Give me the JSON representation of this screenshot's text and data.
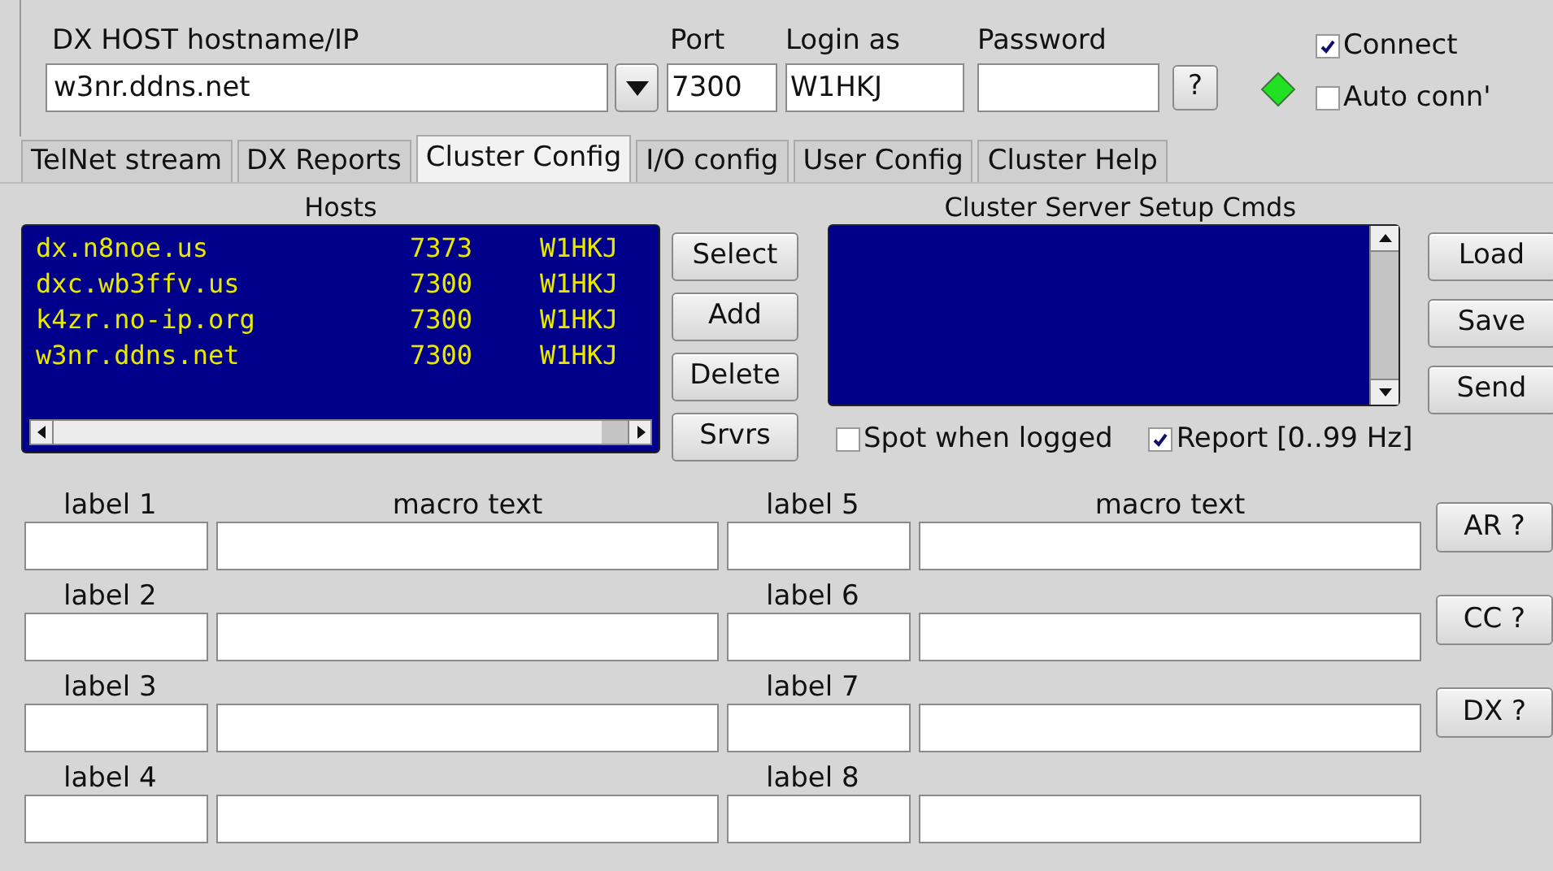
{
  "host": {
    "label": "DX HOST hostname/IP",
    "value": "w3nr.ddns.net"
  },
  "port": {
    "label": "Port",
    "value": "7300"
  },
  "login": {
    "label": "Login as",
    "value": "W1HKJ"
  },
  "password": {
    "label": "Password",
    "button": "?"
  },
  "status": {
    "connected": true
  },
  "connect": {
    "label": "Connect",
    "checked": true
  },
  "auto_connect": {
    "label": "Auto conn'",
    "checked": false
  },
  "tabs": [
    {
      "label": "TelNet stream",
      "selected": false
    },
    {
      "label": "DX Reports",
      "selected": false
    },
    {
      "label": "Cluster Config",
      "selected": true
    },
    {
      "label": "I/O config",
      "selected": false
    },
    {
      "label": "User Config",
      "selected": false
    },
    {
      "label": "Cluster Help",
      "selected": false
    }
  ],
  "hosts": {
    "title": "Hosts",
    "rows": [
      {
        "host": "dx.n8noe.us",
        "port": "7373",
        "login": "W1HKJ"
      },
      {
        "host": "dxc.wb3ffv.us",
        "port": "7300",
        "login": "W1HKJ"
      },
      {
        "host": "k4zr.no-ip.org",
        "port": "7300",
        "login": "W1HKJ"
      },
      {
        "host": "w3nr.ddns.net",
        "port": "7300",
        "login": "W1HKJ"
      }
    ],
    "buttons": [
      "Select",
      "Add",
      "Delete",
      "Srvrs"
    ]
  },
  "setup_cmds": {
    "title": "Cluster Server Setup Cmds",
    "buttons": [
      "Load",
      "Save",
      "Send"
    ]
  },
  "spot_when_logged": {
    "label": "Spot when logged",
    "checked": false
  },
  "report": {
    "label": "Report [0..99 Hz]",
    "checked": true
  },
  "macros": {
    "columns": [
      {
        "label_heading": "label 1",
        "text_heading": "macro text",
        "rows": [
          "label 2",
          "label 3",
          "label 4"
        ]
      },
      {
        "label_heading": "label 5",
        "text_heading": "macro text",
        "rows": [
          "label 6",
          "label 7",
          "label 8"
        ]
      }
    ],
    "buttons": [
      "AR ?",
      "CC ?",
      "DX ?"
    ]
  }
}
